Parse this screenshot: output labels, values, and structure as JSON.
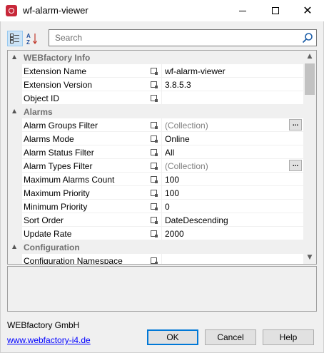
{
  "window": {
    "title": "wf-alarm-viewer"
  },
  "title_bar": {
    "minimize_icon": "minimize-icon",
    "maximize_icon": "maximize-icon",
    "close_glyph": "✕"
  },
  "toolbar": {
    "categorized_icon": "categorized-icon",
    "alphabetical_icon": "sort-az-icon",
    "search_placeholder": "Search",
    "search_value": ""
  },
  "grid": {
    "categories": [
      {
        "name": "WEBfactory Info",
        "expanded": true,
        "properties": [
          {
            "name": "Extension Name",
            "value": "wf-alarm-viewer",
            "dim": false,
            "has_ellipsis": false
          },
          {
            "name": "Extension Version",
            "value": "3.8.5.3",
            "dim": false,
            "has_ellipsis": false
          },
          {
            "name": "Object ID",
            "value": "",
            "dim": false,
            "has_ellipsis": false
          }
        ]
      },
      {
        "name": "Alarms",
        "expanded": true,
        "properties": [
          {
            "name": "Alarm Groups Filter",
            "value": "(Collection)",
            "dim": true,
            "has_ellipsis": true
          },
          {
            "name": "Alarms Mode",
            "value": "Online",
            "dim": false,
            "has_ellipsis": false
          },
          {
            "name": "Alarm Status Filter",
            "value": "All",
            "dim": false,
            "has_ellipsis": false
          },
          {
            "name": "Alarm Types Filter",
            "value": "(Collection)",
            "dim": true,
            "has_ellipsis": true
          },
          {
            "name": "Maximum Alarms Count",
            "value": "100",
            "dim": false,
            "has_ellipsis": false
          },
          {
            "name": "Maximum Priority",
            "value": "100",
            "dim": false,
            "has_ellipsis": false
          },
          {
            "name": "Minimum Priority",
            "value": "0",
            "dim": false,
            "has_ellipsis": false
          },
          {
            "name": "Sort Order",
            "value": "DateDescending",
            "dim": false,
            "has_ellipsis": false
          },
          {
            "name": "Update Rate",
            "value": "2000",
            "dim": false,
            "has_ellipsis": false
          }
        ]
      },
      {
        "name": "Configuration",
        "expanded": true,
        "properties": [
          {
            "name": "Configuration Namespace",
            "value": "",
            "dim": false,
            "has_ellipsis": false
          }
        ]
      }
    ],
    "ellipsis_label": "..."
  },
  "footer": {
    "company": "WEBfactory GmbH",
    "link": "www.webfactory-i4.de",
    "ok_label": "OK",
    "cancel_label": "Cancel",
    "help_label": "Help"
  },
  "colors": {
    "link": "#0000ff",
    "category_text": "#707070",
    "app_icon": "#c8283a",
    "accent": "#0078d7"
  }
}
